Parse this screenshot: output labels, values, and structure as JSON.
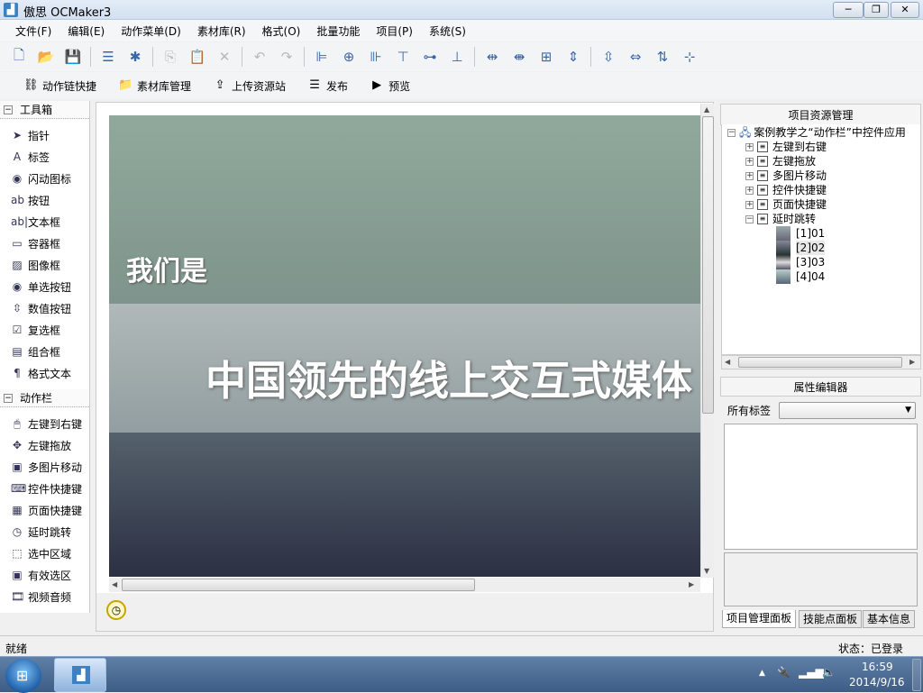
{
  "window": {
    "title": "傲思 OCMaker3",
    "minimize": "─",
    "maximize": "❐",
    "close": "✕"
  },
  "menu": [
    "文件(F)",
    "编辑(E)",
    "动作菜单(D)",
    "素材库(R)",
    "格式(O)",
    "批量功能",
    "项目(P)",
    "系统(S)"
  ],
  "toolbar1": [
    {
      "icon": "new-file-icon",
      "glyph": "🗋",
      "enabled": true
    },
    {
      "icon": "open-folder-icon",
      "glyph": "📂",
      "enabled": true
    },
    {
      "icon": "save-icon",
      "glyph": "💾",
      "enabled": true
    },
    {
      "sep": true
    },
    {
      "icon": "properties-icon",
      "glyph": "☰",
      "enabled": true
    },
    {
      "icon": "puzzle-icon",
      "glyph": "✱",
      "enabled": true
    },
    {
      "sep": true
    },
    {
      "icon": "copy-icon",
      "glyph": "⎘",
      "enabled": false
    },
    {
      "icon": "paste-icon",
      "glyph": "📋",
      "enabled": false
    },
    {
      "icon": "delete-icon",
      "glyph": "✕",
      "enabled": false
    },
    {
      "sep": true
    },
    {
      "icon": "undo-icon",
      "glyph": "↶",
      "enabled": false
    },
    {
      "icon": "redo-icon",
      "glyph": "↷",
      "enabled": false
    },
    {
      "sep": true
    },
    {
      "icon": "align-left-icon",
      "glyph": "⊫",
      "enabled": true
    },
    {
      "icon": "align-center-icon",
      "glyph": "⊕",
      "enabled": true
    },
    {
      "icon": "align-right-icon",
      "glyph": "⊪",
      "enabled": true
    },
    {
      "icon": "align-top-icon",
      "glyph": "⊤",
      "enabled": true
    },
    {
      "icon": "align-middle-icon",
      "glyph": "⊶",
      "enabled": true
    },
    {
      "icon": "align-bottom-icon",
      "glyph": "⊥",
      "enabled": true
    },
    {
      "sep": true
    },
    {
      "icon": "distribute-horizontal-icon",
      "glyph": "⇹",
      "enabled": true
    },
    {
      "icon": "same-width-icon",
      "glyph": "⇼",
      "enabled": true
    },
    {
      "icon": "same-size-icon",
      "glyph": "⊞",
      "enabled": true
    },
    {
      "icon": "same-height-icon",
      "glyph": "⇕",
      "enabled": true
    },
    {
      "sep": true
    },
    {
      "icon": "distribute-vertical-icon",
      "glyph": "⇳",
      "enabled": true
    },
    {
      "icon": "space-horizontal-icon",
      "glyph": "⇔",
      "enabled": true
    },
    {
      "icon": "space-vertical-icon",
      "glyph": "⇅",
      "enabled": true
    },
    {
      "icon": "space-remove-icon",
      "glyph": "⊹",
      "enabled": true
    }
  ],
  "toolbar2": [
    {
      "label": "动作链快捷",
      "icon": "action-chain-icon",
      "glyph": "⛓"
    },
    {
      "label": "素材库管理",
      "icon": "library-folder-icon",
      "glyph": "📁"
    },
    {
      "label": "上传资源站",
      "icon": "upload-icon",
      "glyph": "⇪"
    },
    {
      "label": "发布",
      "icon": "publish-icon",
      "glyph": "☰"
    },
    {
      "label": "预览",
      "icon": "preview-html-icon",
      "glyph": "▶"
    }
  ],
  "toolbox": {
    "title": "工具箱",
    "toggle": "−",
    "items": [
      {
        "label": "指针",
        "icon": "pointer-icon",
        "glyph": "➤"
      },
      {
        "label": "标签",
        "icon": "label-icon",
        "glyph": "A"
      },
      {
        "label": "闪动图标",
        "icon": "flash-icon",
        "glyph": "◉"
      },
      {
        "label": "按钮",
        "icon": "button-icon",
        "glyph": "ab"
      },
      {
        "label": "文本框",
        "icon": "textbox-icon",
        "glyph": "ab|"
      },
      {
        "label": "容器框",
        "icon": "container-icon",
        "glyph": "▭"
      },
      {
        "label": "图像框",
        "icon": "image-icon",
        "glyph": "▨"
      },
      {
        "label": "单选按钮",
        "icon": "radio-icon",
        "glyph": "◉"
      },
      {
        "label": "数值按钮",
        "icon": "spinner-icon",
        "glyph": "⇳"
      },
      {
        "label": "复选框",
        "icon": "checkbox-icon",
        "glyph": "☑"
      },
      {
        "label": "组合框",
        "icon": "combobox-icon",
        "glyph": "▤"
      },
      {
        "label": "格式文本",
        "icon": "richtext-icon",
        "glyph": "¶"
      }
    ]
  },
  "actionbar": {
    "title": "动作栏",
    "toggle": "−",
    "items": [
      {
        "label": "左键到右键",
        "icon": "mouse-icon",
        "glyph": "🖱"
      },
      {
        "label": "左键拖放",
        "icon": "drag-icon",
        "glyph": "✥"
      },
      {
        "label": "多图片移动",
        "icon": "multi-image-icon",
        "glyph": "▣"
      },
      {
        "label": "控件快捷键",
        "icon": "control-shortcut-icon",
        "glyph": "⌨"
      },
      {
        "label": "页面快捷键",
        "icon": "page-shortcut-icon",
        "glyph": "▦"
      },
      {
        "label": "延时跳转",
        "icon": "timer-icon",
        "glyph": "◷"
      },
      {
        "label": "选中区域",
        "icon": "select-area-icon",
        "glyph": "⬚"
      },
      {
        "label": "有效选区",
        "icon": "valid-area-icon",
        "glyph": "▣"
      },
      {
        "label": "视频音频",
        "icon": "video-icon",
        "glyph": "🎞"
      }
    ]
  },
  "canvas": {
    "line1": "我们是",
    "line2": "中国领先的线上交互式媒体"
  },
  "project": {
    "title": "项目资源管理",
    "root": "案例教学之“动作栏”中控件应用",
    "pages": [
      {
        "label": "左键到右键",
        "expanded": false
      },
      {
        "label": "左键拖放",
        "expanded": false
      },
      {
        "label": "多图片移动",
        "expanded": false
      },
      {
        "label": "控件快捷键",
        "expanded": false
      },
      {
        "label": "页面快捷键",
        "expanded": false
      },
      {
        "label": "延时跳转",
        "expanded": true
      }
    ],
    "slides": [
      "[1]01",
      "[2]02",
      "[3]03",
      "[4]04"
    ],
    "selected_slide": "[2]02"
  },
  "properties": {
    "title": "属性编辑器",
    "tag_label": "所有标签",
    "tag_value": ""
  },
  "panel_tabs": [
    "项目管理面板",
    "技能点面板",
    "基本信息"
  ],
  "active_panel_tab": "项目管理面板",
  "status": {
    "left": "就绪",
    "right": "状态：已登录"
  },
  "taskbar": {
    "time": "16:59",
    "date": "2014/9/16",
    "tray_up": "▲"
  },
  "colors": {
    "title_bar": "#d3e0f0",
    "taskbar": "#4a6a93"
  }
}
